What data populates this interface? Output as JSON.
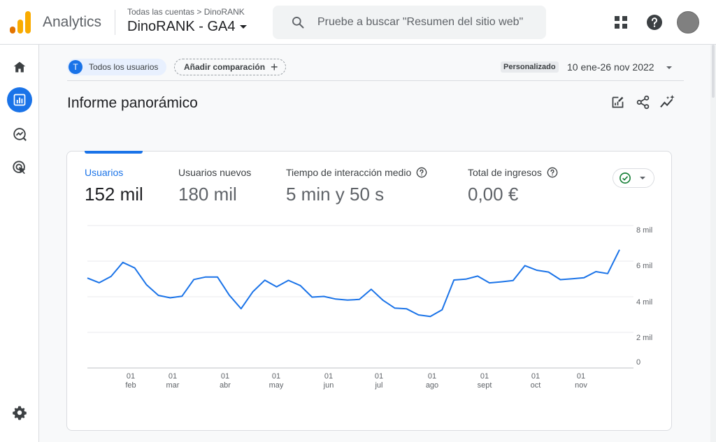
{
  "header": {
    "app_name": "Analytics",
    "breadcrumb": "Todas las cuentas > DinoRANK",
    "property_name": "DinoRANK - GA4",
    "search_placeholder": "Pruebe a buscar \"Resumen del sitio web\"",
    "icons": [
      "analytics-logo",
      "search-icon",
      "apps-grid-icon",
      "help-icon",
      "avatar"
    ]
  },
  "sidenav": {
    "items": [
      {
        "name": "home-icon",
        "active": false
      },
      {
        "name": "reports-icon",
        "active": true
      },
      {
        "name": "explore-icon",
        "active": false
      },
      {
        "name": "advertising-icon",
        "active": false
      }
    ],
    "bottom": [
      "settings-icon",
      "chevron-right-icon"
    ]
  },
  "filters": {
    "segment_initial": "T",
    "segment_label": "Todos los usuarios",
    "add_comparison_label": "Añadir comparación",
    "date_tag": "Personalizado",
    "date_range": "10 ene-26 nov 2022"
  },
  "page": {
    "title": "Informe panorámico",
    "tools": [
      "edit-report-icon",
      "share-icon",
      "insights-icon"
    ]
  },
  "metrics": [
    {
      "label": "Usuarios",
      "value": "152 mil",
      "active": true,
      "help": false
    },
    {
      "label": "Usuarios nuevos",
      "value": "180 mil",
      "active": false,
      "help": false
    },
    {
      "label": "Tiempo de interacción medio",
      "value": "5 min y 50 s",
      "active": false,
      "help": true
    },
    {
      "label": "Total de ingresos",
      "value": "0,00 €",
      "active": false,
      "help": true
    }
  ],
  "colors": {
    "accent": "#1a73e8",
    "compare_check": "#188038",
    "logo_orange": "#f9ab00",
    "logo_dark_orange": "#e37400"
  },
  "chart_data": {
    "type": "line",
    "series": [
      {
        "values": [
          5050,
          4790,
          5140,
          5930,
          5620,
          4670,
          4080,
          3940,
          4030,
          4970,
          5110,
          5110,
          4090,
          3330,
          4290,
          4930,
          4560,
          4920,
          4630,
          3980,
          4020,
          3870,
          3810,
          3850,
          4420,
          3800,
          3360,
          3320,
          2980,
          2890,
          3270,
          4940,
          4990,
          5160,
          4780,
          4840,
          4910,
          5750,
          5490,
          5390,
          4960,
          5010,
          5070,
          5410,
          5300,
          6640
        ]
      }
    ],
    "x_labels": [
      {
        "day": "01",
        "month": "feb"
      },
      {
        "day": "01",
        "month": "mar"
      },
      {
        "day": "01",
        "month": "abr"
      },
      {
        "day": "01",
        "month": "may"
      },
      {
        "day": "01",
        "month": "jun"
      },
      {
        "day": "01",
        "month": "jul"
      },
      {
        "day": "01",
        "month": "ago"
      },
      {
        "day": "01",
        "month": "sept"
      },
      {
        "day": "01",
        "month": "oct"
      },
      {
        "day": "01",
        "month": "nov"
      }
    ],
    "y_ticks": [
      "0",
      "2 mil",
      "4 mil",
      "6 mil",
      "8 mil"
    ],
    "ylim": [
      0,
      8000
    ],
    "grid": true
  }
}
